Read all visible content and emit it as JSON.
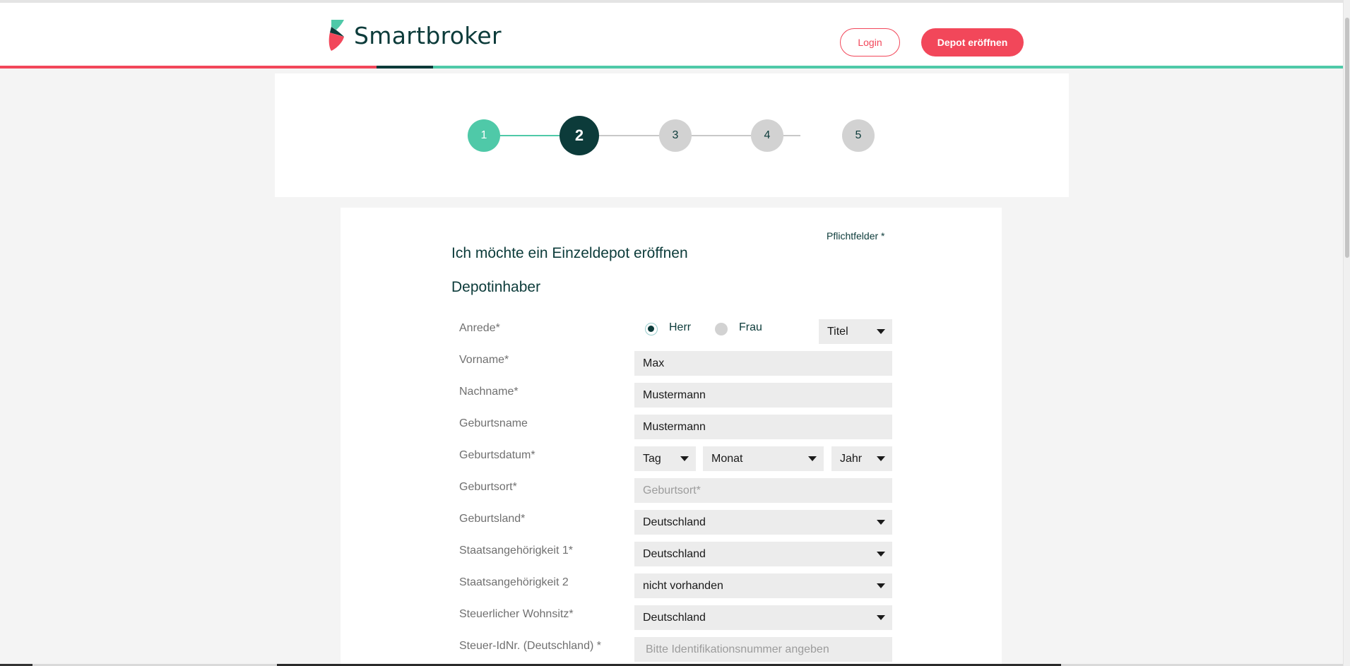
{
  "brand": {
    "name": "Smartbroker",
    "colors": {
      "primary": "#0c3b3a",
      "accent": "#f2475a",
      "teal": "#4fc9a8"
    }
  },
  "header": {
    "login_label": "Login",
    "open_depot_label": "Depot eröffnen"
  },
  "stepper": {
    "steps": [
      {
        "label": "1",
        "state": "done"
      },
      {
        "label": "2",
        "state": "active"
      },
      {
        "label": "3",
        "state": "todo"
      },
      {
        "label": "4",
        "state": "todo"
      },
      {
        "label": "5",
        "state": "todo"
      }
    ]
  },
  "form": {
    "required_note": "Pflichtfelder *",
    "heading": "Ich möchte ein Einzeldepot eröffnen",
    "subheading": "Depotinhaber",
    "salutation": {
      "label": "Anrede*",
      "option_herr": "Herr",
      "option_frau": "Frau",
      "selected": "Herr",
      "title_select": "Titel"
    },
    "first_name": {
      "label": "Vorname*",
      "value": "Max"
    },
    "last_name": {
      "label": "Nachname*",
      "value": "Mustermann"
    },
    "birth_name": {
      "label": "Geburtsname",
      "value": "Mustermann"
    },
    "birth_date": {
      "label": "Geburtsdatum*",
      "day": "Tag",
      "month": "Monat",
      "year": "Jahr"
    },
    "birth_place": {
      "label": "Geburtsort*",
      "placeholder": "Geburtsort*"
    },
    "birth_country": {
      "label": "Geburtsland*",
      "value": "Deutschland"
    },
    "citizenship_1": {
      "label": "Staatsangehörigkeit 1*",
      "value": "Deutschland"
    },
    "citizenship_2": {
      "label": "Staatsangehörigkeit 2",
      "value": "nicht vorhanden"
    },
    "tax_residence": {
      "label": "Steuerlicher Wohnsitz*",
      "value": "Deutschland"
    },
    "tax_id": {
      "label": "Steuer-IdNr. (Deutschland) *",
      "placeholder": "Bitte Identifikationsnummer angeben"
    }
  }
}
